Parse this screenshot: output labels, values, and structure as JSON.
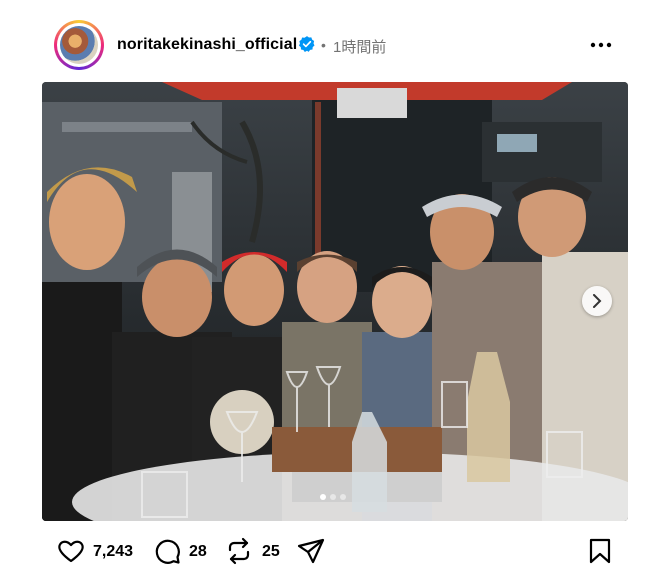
{
  "post": {
    "username": "noritakekinashi_official",
    "separator": "•",
    "time": "1時間前"
  },
  "actions": {
    "likes": "7,243",
    "comments": "28",
    "reposts": "25"
  },
  "carousel": {
    "current_index": 1,
    "total": 3
  },
  "colors": {
    "verified": "#0095f6",
    "muted": "#737373",
    "umbrella": "#c23a2b"
  },
  "icons": {
    "verified": "verified-badge-icon",
    "more": "more-options-icon",
    "like": "heart-icon",
    "comment": "comment-icon",
    "repost": "repost-icon",
    "share": "send-icon",
    "save": "bookmark-icon",
    "next": "chevron-right-icon"
  }
}
